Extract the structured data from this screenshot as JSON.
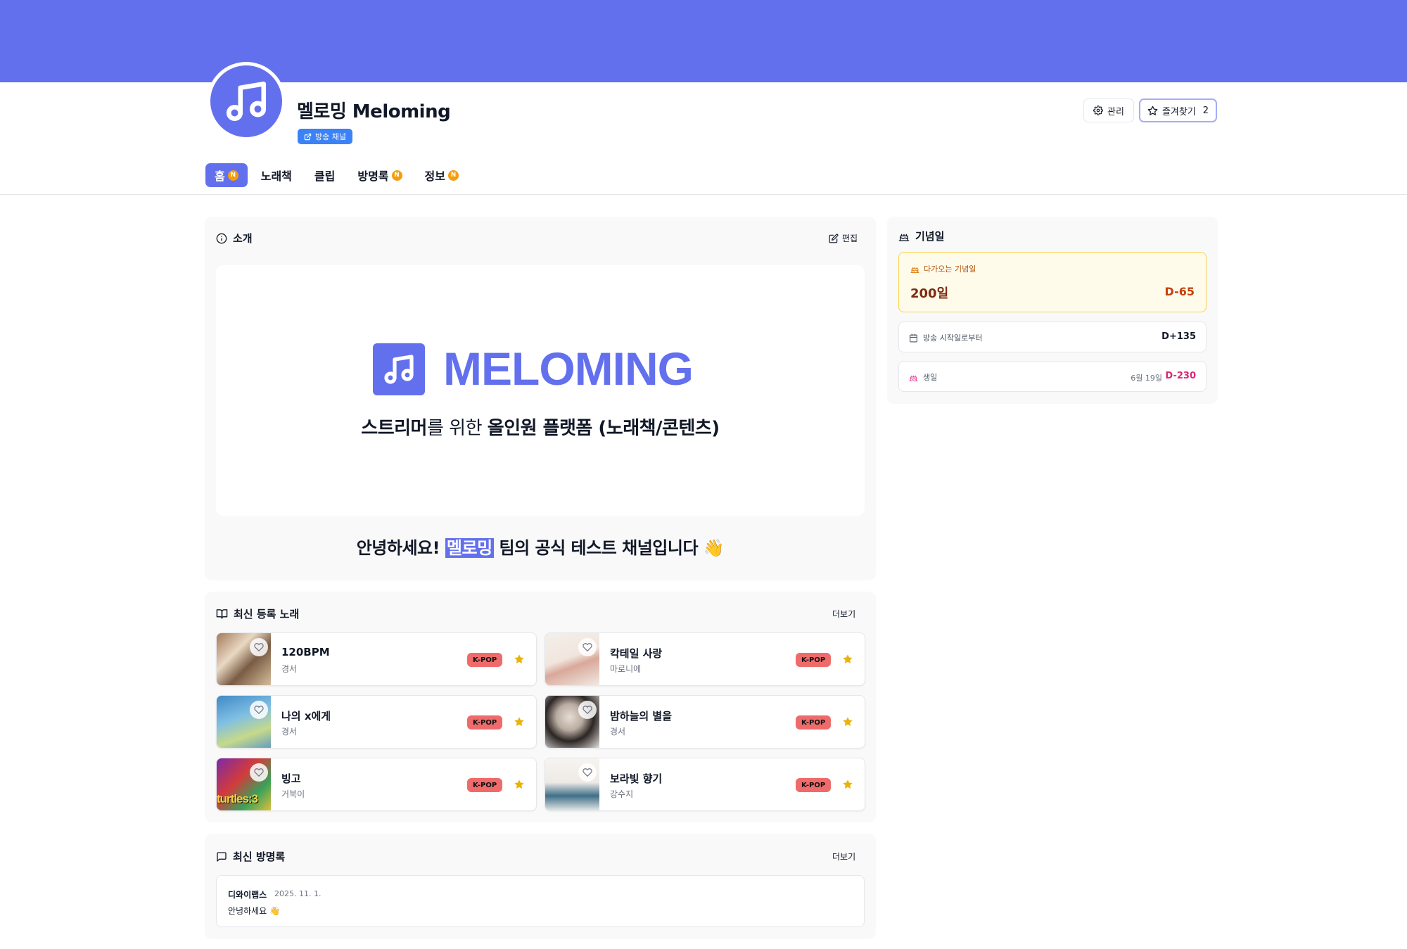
{
  "channel": {
    "name": "멜로밍 Meloming",
    "badge": "방송 채널"
  },
  "header_actions": {
    "manage_label": "관리",
    "favorite_label": "즐겨찾기",
    "favorite_count": "2"
  },
  "tabs": [
    {
      "label": "홈",
      "new": "N",
      "active": true
    },
    {
      "label": "노래책"
    },
    {
      "label": "클립"
    },
    {
      "label": "방명록",
      "new": "N"
    },
    {
      "label": "정보",
      "new": "N"
    }
  ],
  "intro": {
    "title": "소개",
    "edit_label": "편집",
    "logo_word": "MELOMING",
    "tagline_bold1": "스트리머",
    "tagline_thin": "를 위한 ",
    "tagline_bold2": "올인원 플랫폼 (노래책/콘텐츠)",
    "greeting_pre": "안녕하세요! ",
    "greeting_highlight": "멜로밍",
    "greeting_post": " 팀의 공식 테스트 채널입니다 👋"
  },
  "songs_section": {
    "title": "최신 등록 노래",
    "more_label": "더보기",
    "songs": [
      {
        "title": "120BPM",
        "artist": "경서",
        "genre": "K-POP"
      },
      {
        "title": "칵테일 사랑",
        "artist": "마로니에",
        "genre": "K-POP"
      },
      {
        "title": "나의 x에게",
        "artist": "경서",
        "genre": "K-POP"
      },
      {
        "title": "밤하늘의 별을",
        "artist": "경서",
        "genre": "K-POP"
      },
      {
        "title": "빙고",
        "artist": "거북이",
        "genre": "K-POP",
        "art_text": "turtles:3"
      },
      {
        "title": "보라빛 향기",
        "artist": "강수지",
        "genre": "K-POP"
      }
    ]
  },
  "guestbook": {
    "title": "최신 방명록",
    "more_label": "더보기",
    "entry": {
      "author": "디와이랩스",
      "date": "2025. 11. 1.",
      "message": "안녕하세요 👋"
    }
  },
  "anniversary": {
    "title": "기념일",
    "upcoming_label": "다가오는 기념일",
    "upcoming_title": "200일",
    "upcoming_dday": "D-65",
    "broadcast_label": "방송 시작일로부터",
    "broadcast_value": "D+135",
    "birthday_label": "생일",
    "birthday_date": "6월 19일",
    "birthday_dday": "D-230"
  },
  "colors": {
    "accent": "#6370ee",
    "new_badge": "#f59e0b",
    "genre_badge": "#ef6b6b",
    "star": "#eab308"
  }
}
